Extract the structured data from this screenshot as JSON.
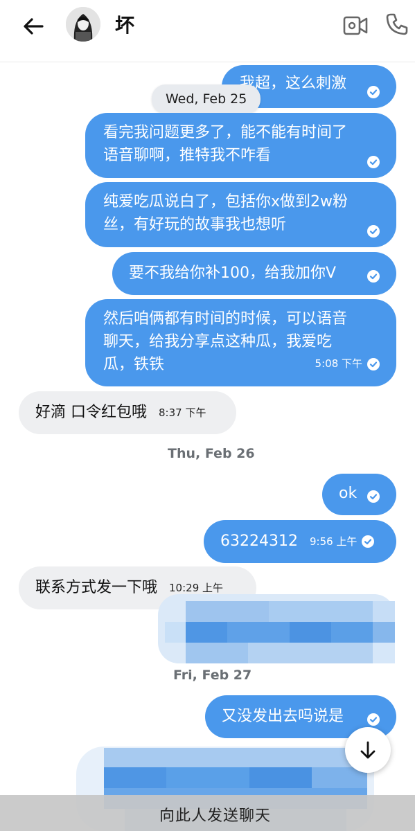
{
  "header": {
    "contact_name": "坏",
    "icons": {
      "back": "back-arrow-icon",
      "video": "video-call-icon",
      "phone": "phone-icon"
    }
  },
  "colors": {
    "outgoing": "#4a98ec",
    "incoming": "#eeeff1",
    "date_pill": "#e8ebef"
  },
  "messages": {
    "m0": {
      "text": "我超，这么刺激"
    },
    "date_pill": "Wed, Feb 25",
    "m1": {
      "line1": "看完我问题更多了，能不能有时间了",
      "line2": "语音聊啊，推特我不咋看"
    },
    "m2": {
      "line1": "纯爱吃瓜说白了，包括你x做到2w粉",
      "line2": "丝，有好玩的故事我也想听"
    },
    "m3": {
      "text": "要不我给你补100，给我加你V"
    },
    "m4": {
      "line1": "然后咱俩都有时间的时候，可以语音",
      "line2": "聊天，给我分享点这种瓜，我爱吃",
      "line3": "瓜，铁铁",
      "time": "5:08 下午"
    },
    "m5": {
      "text": "好滴 口令红包哦",
      "time": "8:37 下午"
    },
    "date2": "Thu, Feb 26",
    "m6": {
      "text": "ok"
    },
    "m7": {
      "text": "63224312",
      "time": "9:56 上午"
    },
    "m8": {
      "text": "联系方式发一下哦",
      "time": "10:29 上午"
    },
    "date3": "Fri, Feb 27",
    "m9": {
      "text": "又没发出去吗说是"
    }
  },
  "bottom_bar": {
    "text": "向此人发送聊天"
  },
  "scroll_button": {
    "icon": "arrow-down-icon"
  }
}
